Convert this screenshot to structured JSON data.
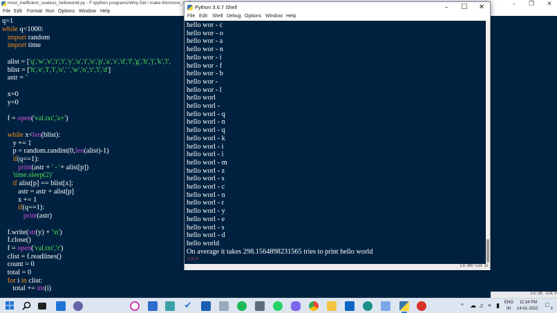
{
  "editor": {
    "title": "most_inefficient_useless_helloworld.py - F:\\python programs\\Why Did i make this\\most_ineff",
    "menu": [
      "File",
      "Edit",
      "Format",
      "Run",
      "Options",
      "Window",
      "Help"
    ],
    "status": {
      "ln": "Ln: 26",
      "col": "Col: 0"
    }
  },
  "shell": {
    "title": "Python 3.6.7 Shell",
    "menu": [
      "File",
      "Edit",
      "Shell",
      "Debug",
      "Options",
      "Window",
      "Help"
    ],
    "output": [
      "hello wor - c",
      "hello wor - o",
      "hello wor - a",
      "hello wor - n",
      "hello wor - i",
      "hello wor - f",
      "hello wor - b",
      "hello wor -",
      "hello wor - l",
      "hello worl",
      "hello worl -",
      "hello worl - q",
      "hello worl - n",
      "hello worl - q",
      "hello worl - k",
      "hello worl - i",
      "hello worl - i",
      "hello worl - m",
      "hello worl - z",
      "hello worl - s",
      "hello worl - c",
      "hello worl - n",
      "hello worl - r",
      "hello worl - y",
      "hello worl - e",
      "hello worl - s",
      "hello worl - d",
      "hello world",
      "On average it takes 298.1564898231565 tries to print hello world"
    ],
    "prompt": ">>>",
    "status": {
      "ln": "Ln: 487",
      "col": "Col: 11"
    }
  },
  "taskbar": {
    "icons": [
      "windows-start-icon",
      "search-icon",
      "task-view-icon",
      "widgets-icon",
      "teams-chat-icon",
      "opera-icon",
      "files-icon",
      "snipping-icon",
      "todo-icon",
      "photos-icon",
      "spotify-icon",
      "notepad-icon",
      "whatsapp-icon",
      "copilot-icon",
      "chrome-icon",
      "file-explorer-icon",
      "outlook-icon",
      "edge-icon",
      "paint-icon",
      "idle-python-icon",
      "record-icon"
    ],
    "tray": {
      "lang_top": "ENG",
      "lang_bottom": "IN",
      "time": "11:34 PM",
      "date": "14-01-2022",
      "notifications": "8"
    }
  },
  "colors": {
    "idle_bg": "#002240",
    "keyword": "#ff8c1a",
    "builtin": "#d050e0",
    "string": "#54e05a",
    "prompt": "#ff4040"
  }
}
